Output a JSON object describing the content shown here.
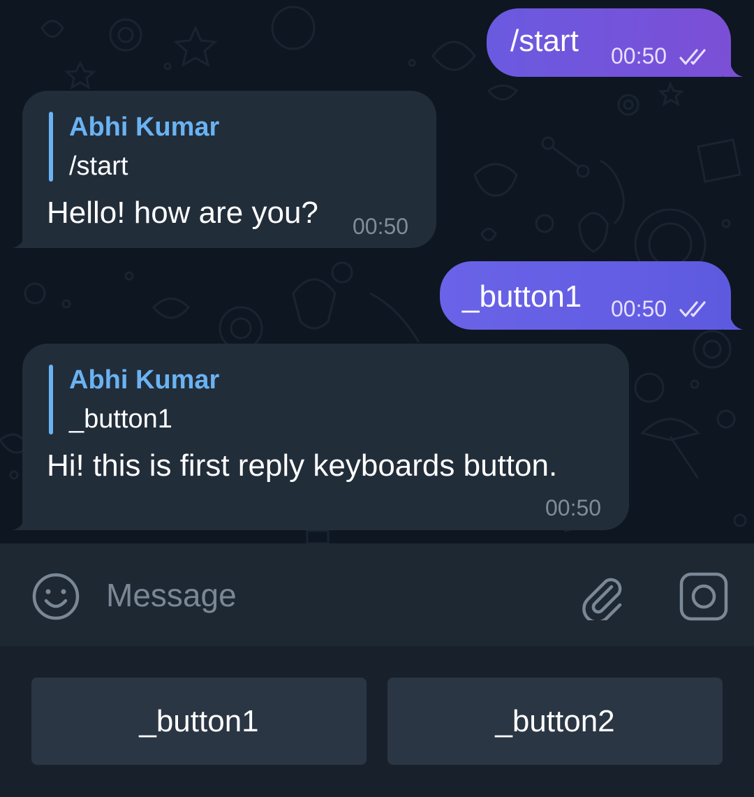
{
  "colors": {
    "chat_background": "#0e1621",
    "outgoing_bubble": "#6a5ae0",
    "incoming_bubble": "#222d3a",
    "reply_accent": "#6ab3f3",
    "input_bar": "#1e2833",
    "keyboard_background": "#18212b",
    "keyboard_button": "#2a3644"
  },
  "messages": [
    {
      "direction": "outgoing",
      "text": "/start",
      "time": "00:50",
      "status": "read"
    },
    {
      "direction": "incoming",
      "reply_to_name": "Abhi Kumar",
      "reply_to_text": "/start",
      "text": "Hello! how are you?",
      "time": "00:50"
    },
    {
      "direction": "outgoing",
      "text": "_button1",
      "time": "00:50",
      "status": "read"
    },
    {
      "direction": "incoming",
      "reply_to_name": "Abhi Kumar",
      "reply_to_text": "_button1",
      "text": "Hi! this is first reply keyboards button.",
      "time": "00:50"
    }
  ],
  "composer": {
    "placeholder": "Message",
    "left_icon": "emoji-icon",
    "right_icons": [
      "attach-icon",
      "camera-icon"
    ]
  },
  "reply_keyboard": {
    "buttons": [
      "_button1",
      "_button2"
    ]
  }
}
